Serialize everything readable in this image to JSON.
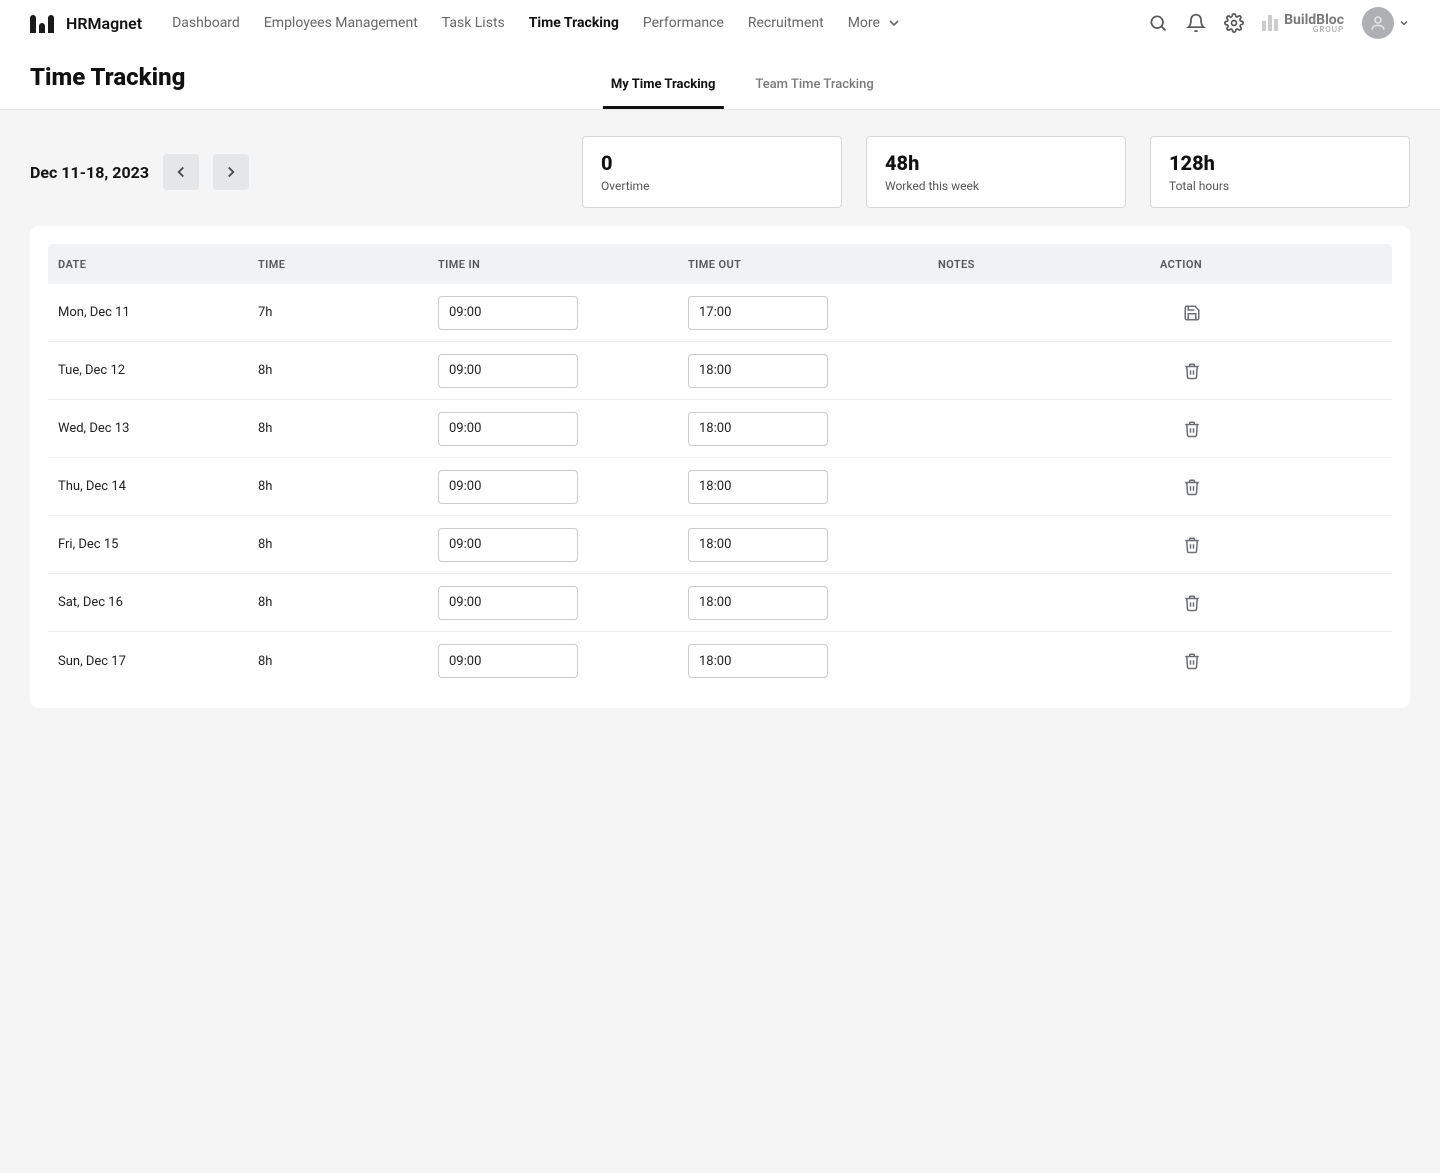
{
  "brand": {
    "name": "HRMagnet"
  },
  "nav": {
    "items": [
      {
        "label": "Dashboard",
        "active": false
      },
      {
        "label": "Employees Management",
        "active": false
      },
      {
        "label": "Task Lists",
        "active": false
      },
      {
        "label": "Time Tracking",
        "active": true
      },
      {
        "label": "Performance",
        "active": false
      },
      {
        "label": "Recruitment",
        "active": false
      }
    ],
    "more_label": "More"
  },
  "company": {
    "name": "BuildBloc",
    "sub": "GROUP"
  },
  "page": {
    "title": "Time Tracking",
    "tabs": [
      {
        "label": "My Time Tracking",
        "active": true
      },
      {
        "label": "Team Time Tracking",
        "active": false
      }
    ]
  },
  "range": {
    "label": "Dec 11-18, 2023"
  },
  "stats": [
    {
      "value": "0",
      "label": "Overtime"
    },
    {
      "value": "48h",
      "label": "Worked this week"
    },
    {
      "value": "128h",
      "label": "Total hours"
    }
  ],
  "table": {
    "headers": {
      "date": "DATE",
      "time": "TIME",
      "time_in": "TIME IN",
      "time_out": "TIME OUT",
      "notes": "NOTES",
      "action": "ACTION"
    },
    "rows": [
      {
        "date": "Mon, Dec 11",
        "time": "7h",
        "time_in": "09:00",
        "time_out": "17:00",
        "notes": "",
        "action": "save"
      },
      {
        "date": "Tue, Dec 12",
        "time": "8h",
        "time_in": "09:00",
        "time_out": "18:00",
        "notes": "",
        "action": "delete"
      },
      {
        "date": "Wed, Dec 13",
        "time": "8h",
        "time_in": "09:00",
        "time_out": "18:00",
        "notes": "",
        "action": "delete"
      },
      {
        "date": "Thu, Dec 14",
        "time": "8h",
        "time_in": "09:00",
        "time_out": "18:00",
        "notes": "",
        "action": "delete"
      },
      {
        "date": "Fri, Dec 15",
        "time": "8h",
        "time_in": "09:00",
        "time_out": "18:00",
        "notes": "",
        "action": "delete"
      },
      {
        "date": "Sat, Dec 16",
        "time": "8h",
        "time_in": "09:00",
        "time_out": "18:00",
        "notes": "",
        "action": "delete"
      },
      {
        "date": "Sun, Dec 17",
        "time": "8h",
        "time_in": "09:00",
        "time_out": "18:00",
        "notes": "",
        "action": "delete"
      }
    ]
  },
  "icons": {
    "search": "search-icon",
    "bell": "bell-icon",
    "gear": "gear-icon",
    "chevron_down": "chevron-down-icon",
    "chevron_left": "chevron-left-icon",
    "chevron_right": "chevron-right-icon",
    "user": "user-icon",
    "save": "save-icon",
    "trash": "trash-icon"
  }
}
